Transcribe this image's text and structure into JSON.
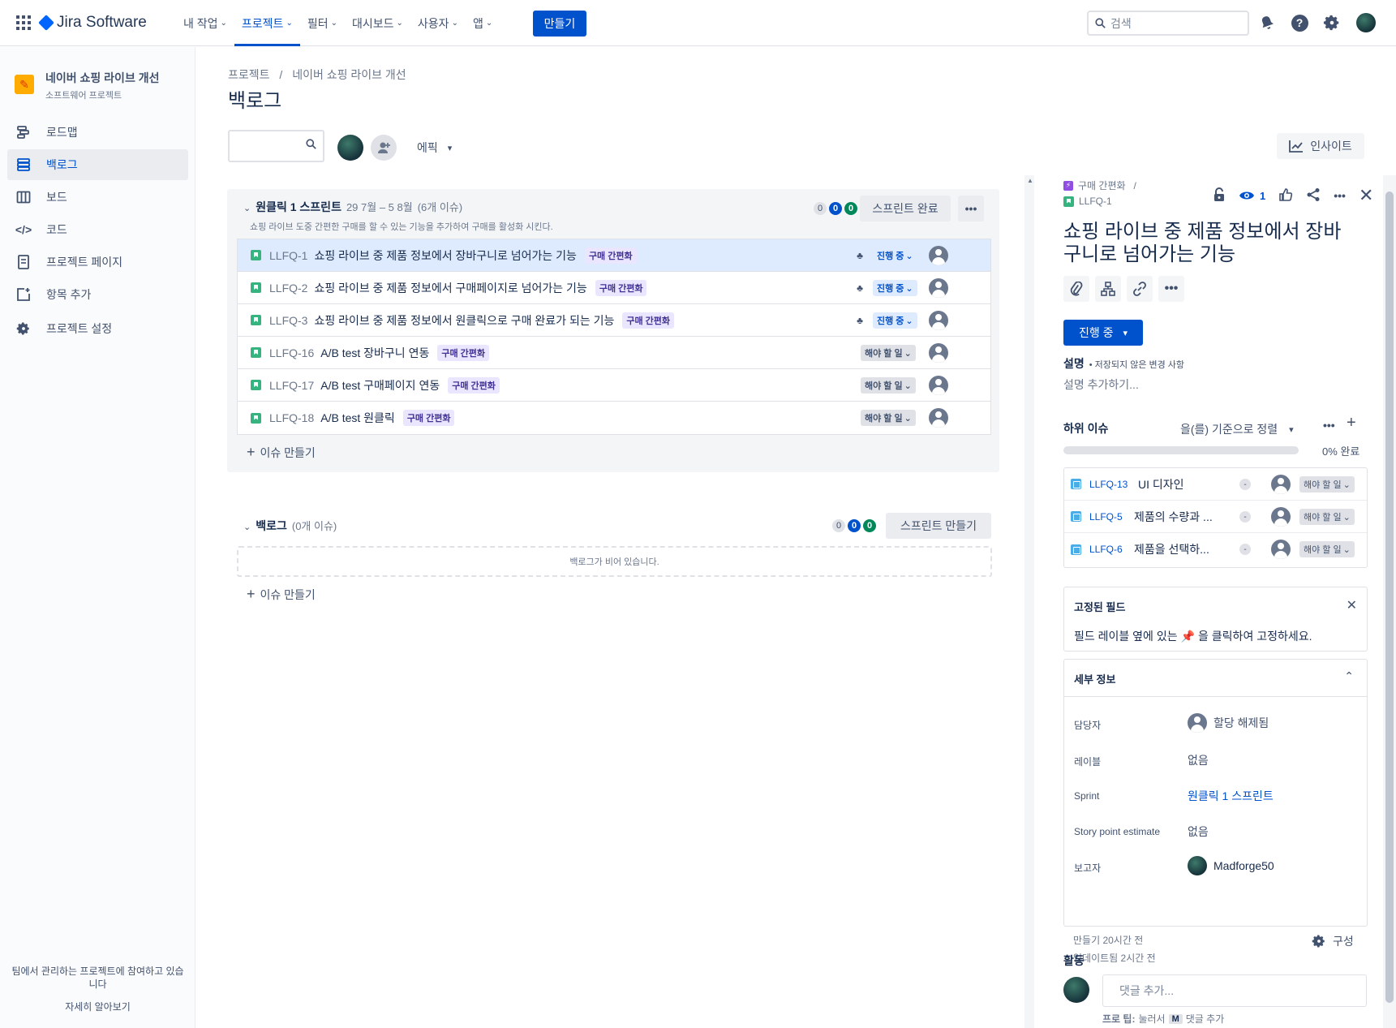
{
  "app": {
    "name": "Jira Software"
  },
  "nav": {
    "items": [
      "내 작업",
      "프로젝트",
      "필터",
      "대시보드",
      "사용자",
      "앱"
    ],
    "create": "만들기",
    "search_placeholder": "검색"
  },
  "sidebar": {
    "project_name": "네이버 쇼핑 라이브 개선",
    "project_type": "소프트웨어 프로젝트",
    "items": [
      {
        "label": "로드맵",
        "icon": "roadmap-icon"
      },
      {
        "label": "백로그",
        "icon": "backlog-icon"
      },
      {
        "label": "보드",
        "icon": "board-icon"
      },
      {
        "label": "코드",
        "icon": "code-icon"
      },
      {
        "label": "프로젝트 페이지",
        "icon": "page-icon"
      },
      {
        "label": "항목 추가",
        "icon": "add-item-icon"
      },
      {
        "label": "프로젝트 설정",
        "icon": "settings-icon"
      }
    ],
    "footer_text": "팀에서 관리하는 프로젝트에 참여하고 있습니다",
    "footer_link": "자세히 알아보기"
  },
  "main": {
    "breadcrumb_root": "프로젝트",
    "breadcrumb_sep": "/",
    "breadcrumb_project": "네이버 쇼핑 라이브 개선",
    "title": "백로그",
    "epic_filter": "에픽",
    "insight": "인사이트"
  },
  "sprint": {
    "name": "원클릭 1 스프린트",
    "dates": "29 7월 – 5 8월",
    "count": "(6개 이슈)",
    "goal": "쇼핑 라이브 도중 간편한 구매를 할 수 있는 기능을 추가하여 구매를 활성화 시킨다.",
    "badges": [
      "0",
      "0",
      "0"
    ],
    "complete_btn": "스프린트 완료",
    "issues": [
      {
        "key": "LLFQ-1",
        "summary": "쇼핑 라이브 중 제품 정보에서 장바구니로 넘어가는 기능",
        "epic": "구매 간편화",
        "status": "진행 중",
        "has_children": true
      },
      {
        "key": "LLFQ-2",
        "summary": "쇼핑 라이브 중 제품 정보에서 구매페이지로 넘어가는 기능",
        "epic": "구매 간편화",
        "status": "진행 중",
        "has_children": true
      },
      {
        "key": "LLFQ-3",
        "summary": "쇼핑 라이브 중 제품 정보에서 원클릭으로 구매 완료가 되는 기능",
        "epic": "구매 간편화",
        "status": "진행 중",
        "has_children": true
      },
      {
        "key": "LLFQ-16",
        "summary": "A/B test 장바구니 연동",
        "epic": "구매 간편화",
        "status": "해야 할 일",
        "has_children": false
      },
      {
        "key": "LLFQ-17",
        "summary": "A/B test 구매페이지 연동",
        "epic": "구매 간편화",
        "status": "해야 할 일",
        "has_children": false
      },
      {
        "key": "LLFQ-18",
        "summary": "A/B test 원클릭",
        "epic": "구매 간편화",
        "status": "해야 할 일",
        "has_children": false
      }
    ],
    "create_issue": "이슈 만들기"
  },
  "backlog": {
    "name": "백로그",
    "count": "(0개 이슈)",
    "badges": [
      "0",
      "0",
      "0"
    ],
    "create_sprint_btn": "스프린트 만들기",
    "empty_text": "백로그가 비어 있습니다.",
    "create_issue": "이슈 만들기"
  },
  "panel": {
    "epic_crumb": "구매 간편화",
    "crumb_sep": "/",
    "issue_key": "LLFQ-1",
    "watch_count": "1",
    "title": "쇼핑 라이브 중 제품 정보에서 장바구니로 넘어가는 기능",
    "status": "진행 중",
    "description_label": "설명",
    "unsaved_note": "• 저장되지 않은 변경 사항",
    "description_placeholder": "설명 추가하기...",
    "subtasks_label": "하위 이슈",
    "sort_label": "을(를) 기준으로 정렬",
    "progress_percent": 0,
    "progress_text": "0% 완료",
    "subtasks": [
      {
        "key": "LLFQ-13",
        "summary": "UI 디자인",
        "priority": "-",
        "status": "해야 할 일"
      },
      {
        "key": "LLFQ-5",
        "summary": "제품의 수량과 ...",
        "priority": "-",
        "status": "해야 할 일"
      },
      {
        "key": "LLFQ-6",
        "summary": "제품을 선택하...",
        "priority": "-",
        "status": "해야 할 일"
      }
    ],
    "pinned_label": "고정된 필드",
    "pinned_text_pre": "필드 레이블 옆에 있는",
    "pinned_text_post": "을 클릭하여 고정하세요.",
    "details_label": "세부 정보",
    "details": [
      {
        "label": "담당자",
        "value": "할당 해제됨"
      },
      {
        "label": "레이블",
        "value": "없음"
      },
      {
        "label": "Sprint",
        "value": "원클릭 1 스프린트"
      },
      {
        "label": "Story point estimate",
        "value": "없음"
      },
      {
        "label": "보고자",
        "value": "Madforge50"
      }
    ],
    "created": "만들기 20시간 전",
    "updated": "업데이트됨 2시간 전",
    "configure": "구성",
    "activity_label": "활동",
    "comment_placeholder": "댓글 추가...",
    "tip_pre": "프로 팁:",
    "tip_mid": "눌러서",
    "tip_key": "M",
    "tip_post": "댓글 추가"
  },
  "colors": {
    "primary": "#0052CC",
    "epic_bg": "#EAE6FF",
    "story": "#36B37E",
    "done": "#00875A"
  }
}
